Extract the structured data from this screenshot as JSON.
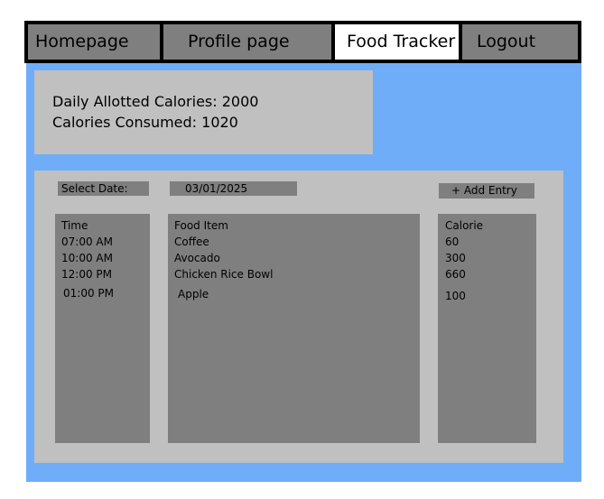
{
  "nav": {
    "tabs": [
      {
        "label": "Homepage"
      },
      {
        "label": "Profile page"
      },
      {
        "label": "Food Tracker"
      },
      {
        "label": "Logout"
      }
    ],
    "active_tab": "Food Tracker"
  },
  "summary": {
    "allotted": "Daily Allotted Calories: 2000",
    "consumed": "Calories Consumed: 1020"
  },
  "tracker": {
    "date_label": "Select Date:",
    "date_value": "03/01/2025",
    "add_button": "+ Add Entry",
    "columns": {
      "time_header": "Time",
      "food_header": "Food Item",
      "calorie_header": "Calorie"
    },
    "entries": [
      {
        "time": "07:00 AM",
        "food": "Coffee",
        "calorie": "60"
      },
      {
        "time": "10:00 AM",
        "food": "Avocado",
        "calorie": "300"
      },
      {
        "time": "12:00 PM",
        "food": "Chicken Rice Bowl",
        "calorie": "660"
      },
      {
        "time": "01:00 PM",
        "food": "Apple",
        "calorie": "100"
      }
    ]
  },
  "colors": {
    "nav_border": "#000000",
    "tab_bg": "#7f7f7f",
    "active_tab_bg": "#ffffff",
    "content_bg": "#6fadf8",
    "panel_bg": "#c0c0c0",
    "column_bg": "#7f7f7f"
  }
}
